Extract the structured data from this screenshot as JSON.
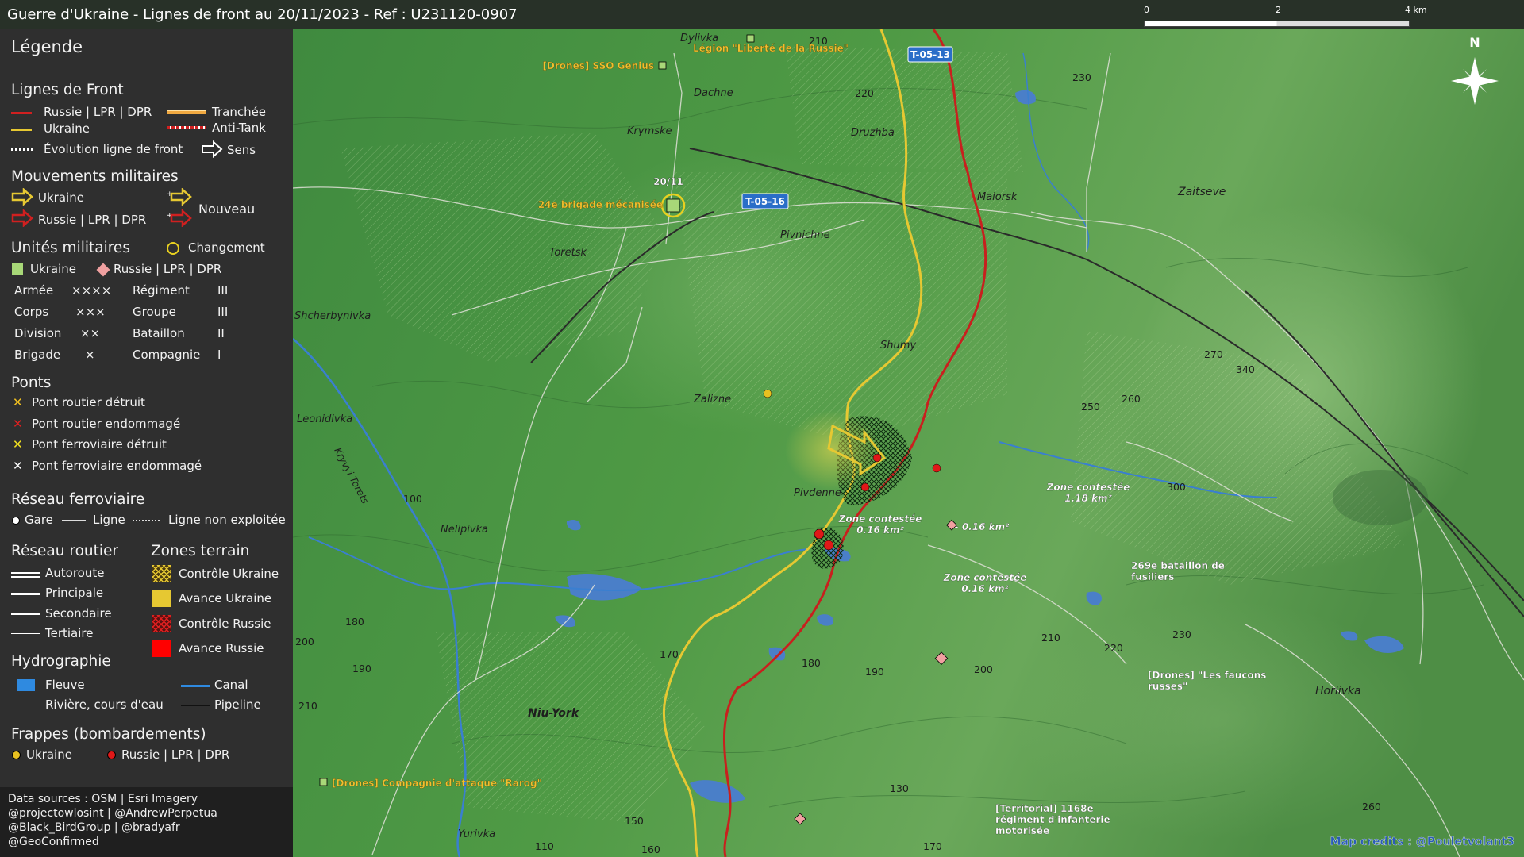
{
  "title": "Guerre d'Ukraine - Lignes de front au 20/11/2023 - Ref : U231120-0907",
  "legend": {
    "title": "Légende",
    "front_lines": {
      "heading": "Lignes de Front",
      "russia": "Russie | LPR | DPR",
      "ukraine": "Ukraine",
      "trench": "Tranchée",
      "anti_tank": "Anti-Tank",
      "evolution": "Évolution ligne de front",
      "direction": "Sens"
    },
    "movements": {
      "heading": "Mouvements militaires",
      "ukraine": "Ukraine",
      "russia": "Russie | LPR | DPR",
      "new": "Nouveau"
    },
    "units": {
      "heading": "Unités militaires",
      "change": "Changement",
      "ukraine": "Ukraine",
      "russia": "Russie | LPR | DPR",
      "rows": [
        {
          "a": "Armée",
          "as": "××××",
          "b": "Régiment",
          "bs": "III"
        },
        {
          "a": "Corps",
          "as": "×××",
          "b": "Groupe",
          "bs": "III"
        },
        {
          "a": "Division",
          "as": "××",
          "b": "Bataillon",
          "bs": "II"
        },
        {
          "a": "Brigade",
          "as": "×",
          "b": "Compagnie",
          "bs": "I"
        }
      ]
    },
    "bridges": {
      "heading": "Ponts",
      "road_destroyed": "Pont routier détruit",
      "road_damaged": "Pont routier endommagé",
      "rail_destroyed": "Pont ferroviaire détruit",
      "rail_damaged": "Pont ferroviaire endommagé"
    },
    "rail": {
      "heading": "Réseau ferroviaire",
      "station": "Gare",
      "line": "Ligne",
      "unused": "Ligne non exploitée"
    },
    "roads": {
      "heading": "Réseau routier",
      "motorway": "Autoroute",
      "main": "Principale",
      "secondary": "Secondaire",
      "tertiary": "Tertiaire"
    },
    "zones": {
      "heading": "Zones terrain",
      "ua_control": "Contrôle Ukraine",
      "ua_advance": "Avance Ukraine",
      "ru_control": "Contrôle Russie",
      "ru_advance": "Avance Russie"
    },
    "hydro": {
      "heading": "Hydrographie",
      "river": "Fleuve",
      "stream": "Rivière, cours d'eau",
      "canal": "Canal",
      "pipeline": "Pipeline"
    },
    "strikes": {
      "heading": "Frappes (bombardements)",
      "ukraine": "Ukraine",
      "russia": "Russie | LPR | DPR"
    },
    "sources": [
      "Data sources : OSM | Esri Imagery",
      "@projectowlosint | @AndrewPerpetua",
      "@Black_BirdGroup | @bradyafr",
      "@GeoConfirmed"
    ]
  },
  "scale": {
    "t0": "0",
    "t1": "2",
    "t2": "4 km"
  },
  "north": "N",
  "credits": "Map credits : @Pouletvolant3",
  "colors": {
    "russia_line": "#c8201e",
    "ukraine_line": "#e6c832",
    "map_green": "#4f9a45",
    "water": "#4a7fc8",
    "unit_ua": "#a8d878",
    "unit_ru": "#f0a0a0",
    "strike_ru": "#e01818",
    "strike_ua": "#e8c020"
  },
  "map": {
    "places": [
      {
        "id": "dylivka",
        "text": "Dylivka"
      },
      {
        "id": "dachne",
        "text": "Dachne"
      },
      {
        "id": "krymske",
        "text": "Krymske"
      },
      {
        "id": "druzhba",
        "text": "Druzhba"
      },
      {
        "id": "mayorsk",
        "text": "Maiorsk"
      },
      {
        "id": "zaitseve",
        "text": "Zaitseve"
      },
      {
        "id": "toretsk",
        "text": "Toretsk"
      },
      {
        "id": "pivnichne",
        "text": "Pivnichne"
      },
      {
        "id": "shcherbynivka",
        "text": "Shcherbynivka"
      },
      {
        "id": "shumy",
        "text": "Shumy"
      },
      {
        "id": "zalizne",
        "text": "Zalizne"
      },
      {
        "id": "leonidivka",
        "text": "Leonidivka"
      },
      {
        "id": "pivdenne",
        "text": "Pivdenne"
      },
      {
        "id": "nelipivka",
        "text": "Nelipivka"
      },
      {
        "id": "niu-york",
        "text": "Niu-York"
      },
      {
        "id": "horlivka",
        "text": "Horlivka"
      },
      {
        "id": "yurivka",
        "text": "Yurivka"
      },
      {
        "id": "kryvyi-torets",
        "text": "Kryvyi Torets"
      }
    ],
    "altitudes": [
      "210",
      "230",
      "220",
      "270",
      "340",
      "250",
      "260",
      "300",
      "100",
      "180",
      "200",
      "190",
      "210",
      "170",
      "180",
      "190",
      "200",
      "210",
      "220",
      "230",
      "130",
      "150",
      "160",
      "110",
      "170",
      "260"
    ],
    "roads": [
      "T-05-13",
      "T-05-16"
    ],
    "units": [
      {
        "id": "legion",
        "text": "Légion \"Liberté de la Russie\""
      },
      {
        "id": "sso",
        "text": "[Drones] SSO Genius"
      },
      {
        "id": "brigade24",
        "date": "20/11",
        "text": "24e brigade mécanisée"
      },
      {
        "id": "bat269",
        "text1": "269e bataillon de",
        "text2": "fusiliers"
      },
      {
        "id": "faucons",
        "text1": "[Drones] \"Les faucons",
        "text2": "russes\""
      },
      {
        "id": "rarog",
        "text": "[Drones] Compagnie d'attaque \"Rarog\""
      },
      {
        "id": "terr1168",
        "text1": "[Territorial] 1168e",
        "text2": "régiment d'infanterie",
        "text3": "motorisée"
      }
    ],
    "zones": [
      {
        "id": "z1",
        "t1": "Zone contestée",
        "t2": "1.18 km²"
      },
      {
        "id": "z2",
        "t1": "Zone contestée",
        "t2": "0.16 km²"
      },
      {
        "id": "z3",
        "t1": "- 0.16 km²"
      },
      {
        "id": "z4",
        "t1": "Zone contestée",
        "t2": "0.16 km²"
      }
    ]
  }
}
